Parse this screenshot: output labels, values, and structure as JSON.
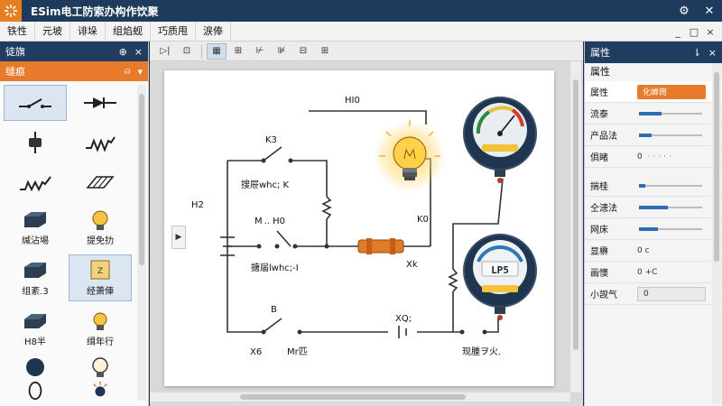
{
  "window": {
    "title": "ESim电工防索办构作饮聚",
    "actions": [
      "gear-icon",
      "close-icon"
    ]
  },
  "menu": {
    "items": [
      "铁性",
      "元坡",
      "诽垛",
      "组焰蚬",
      "巧质甩",
      "涙俸"
    ],
    "right": [
      "_",
      "□",
      "×"
    ]
  },
  "left_panel": {
    "title": "徒旗",
    "header_actions": [
      "⊕",
      "×"
    ],
    "search_label": "缝痕",
    "components": [
      {
        "label": "",
        "icon": "switch-icon"
      },
      {
        "label": "",
        "icon": "diode-icon"
      },
      {
        "label": "",
        "icon": "capacitor-icon"
      },
      {
        "label": "",
        "icon": "resistor-icon"
      },
      {
        "label": "",
        "icon": "inductor-icon"
      },
      {
        "label": "",
        "icon": "fuse-block-icon"
      },
      {
        "label": "缄沾埸",
        "icon": "battery-block-icon"
      },
      {
        "label": "提免扐",
        "icon": "bulb-icon"
      },
      {
        "label": "组紊.3",
        "icon": "cube-icon"
      },
      {
        "label": "经萧俥",
        "icon": "tool-icon"
      },
      {
        "label": "H8半",
        "icon": "box-icon"
      },
      {
        "label": "缉年行",
        "icon": "bulb-small-icon"
      },
      {
        "label": "",
        "icon": "circle-icon"
      },
      {
        "label": "",
        "icon": "bulb-outline-icon"
      },
      {
        "label": "",
        "icon": "ring-icon"
      },
      {
        "label": "",
        "icon": "led-icon"
      }
    ]
  },
  "toolbar": {
    "buttons": [
      "▷|",
      "⊡",
      "▦",
      "⊞",
      "⊬",
      "⊯",
      "⊟",
      "⊞"
    ]
  },
  "canvas": {
    "labels": {
      "top": "HI0",
      "k3": "K3",
      "sw1": "搜屉whc; K",
      "h2": "H2",
      "m_h0": "M .. H0",
      "k0": "K0",
      "sw2": "搪届lwhc;-I",
      "xk": "Xk",
      "b": "B",
      "xq": "XQ;",
      "x6": "X6",
      "mc": "Mr匹",
      "bottom_right": "现腫ヲ火.",
      "meter2": "LP5"
    }
  },
  "right_panel": {
    "title": "属性",
    "header_actions": [
      "⇂",
      "×"
    ],
    "section": "属性",
    "rows": [
      {
        "label": "属性",
        "value": "化蝉崗",
        "kind": "select-highlight"
      },
      {
        "label": "流泰",
        "value": "",
        "kind": "slider",
        "fill": 0.35
      },
      {
        "label": "产品法",
        "value": "",
        "kind": "slider-dots",
        "fill": 0.2
      },
      {
        "label": "俱睹",
        "value": "0",
        "kind": "dots"
      },
      {
        "label": "揣桂",
        "value": "",
        "kind": "slider-dots",
        "fill": 0.1
      },
      {
        "label": "仝漶法",
        "value": "",
        "kind": "slider",
        "fill": 0.45
      },
      {
        "label": "网床",
        "value": "",
        "kind": "slider-dots",
        "fill": 0.3
      },
      {
        "label": "显楙",
        "value": "0 c",
        "kind": "text"
      },
      {
        "label": "画懊",
        "value": "0 +C",
        "kind": "text"
      },
      {
        "label": "小觊气",
        "value": "0",
        "kind": "select"
      }
    ]
  },
  "colors": {
    "accent": "#e87a2c",
    "titlebar": "#1e3a5c",
    "panel_header": "#203d60",
    "wire": "#333333",
    "fuse": "#e07b2a"
  }
}
